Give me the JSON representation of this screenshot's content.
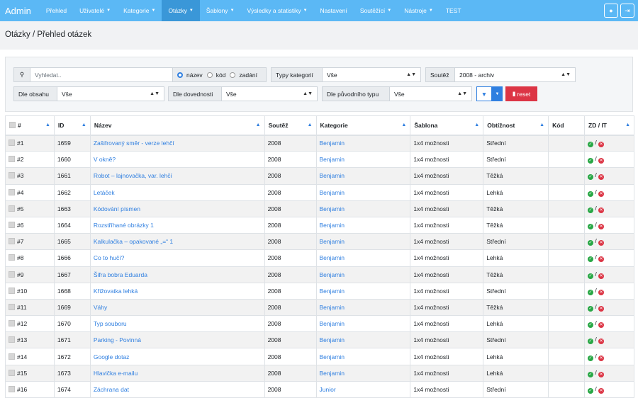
{
  "nav": {
    "brand": "Admin",
    "items": [
      {
        "label": "Přehled",
        "caret": false,
        "active": false
      },
      {
        "label": "Uživatelé",
        "caret": true,
        "active": false
      },
      {
        "label": "Kategorie",
        "caret": true,
        "active": false
      },
      {
        "label": "Otázky",
        "caret": true,
        "active": true
      },
      {
        "label": "Šablony",
        "caret": true,
        "active": false
      },
      {
        "label": "Výsledky a statistiky",
        "caret": true,
        "active": false
      },
      {
        "label": "Nastavení",
        "caret": false,
        "active": false
      },
      {
        "label": "Soutěžící",
        "caret": true,
        "active": false
      },
      {
        "label": "Nástroje",
        "caret": true,
        "active": false
      },
      {
        "label": "TEST",
        "caret": false,
        "active": false
      }
    ]
  },
  "breadcrumb": "Otázky / Přehled otázek",
  "filters": {
    "search_placeholder": "Vyhledat..",
    "radio": [
      "název",
      "kód",
      "zadání"
    ],
    "typy_label": "Typy kategorií",
    "typy_value": "Vše",
    "soutez_label": "Soutěž",
    "soutez_value": "2008 - archiv",
    "obsah_label": "Dle obsahu",
    "obsah_value": "Vše",
    "dovednosti_label": "Dle dovednosti",
    "dovednosti_value": "Vše",
    "puvodni_label": "Dle původního typu",
    "puvodni_value": "Vše",
    "reset_label": "reset"
  },
  "table": {
    "headers": [
      "#",
      "ID",
      "Název",
      "Soutěž",
      "Kategorie",
      "Šablona",
      "Obtížnost",
      "Kód",
      "ZD / IT"
    ],
    "rows": [
      {
        "num": "#1",
        "id": "1659",
        "name": "Zašifrovaný směr - verze lehčí",
        "soutez": "2008",
        "kat": "Benjamin",
        "sablona": "1x4 možnosti",
        "obt": "Střední"
      },
      {
        "num": "#2",
        "id": "1660",
        "name": "V okně?",
        "soutez": "2008",
        "kat": "Benjamin",
        "sablona": "1x4 možnosti",
        "obt": "Střední"
      },
      {
        "num": "#3",
        "id": "1661",
        "name": "Robot – lajnovačka, var. lehčí",
        "soutez": "2008",
        "kat": "Benjamin",
        "sablona": "1x4 možnosti",
        "obt": "Těžká"
      },
      {
        "num": "#4",
        "id": "1662",
        "name": "Letáček",
        "soutez": "2008",
        "kat": "Benjamin",
        "sablona": "1x4 možnosti",
        "obt": "Lehká"
      },
      {
        "num": "#5",
        "id": "1663",
        "name": "Kódování písmen",
        "soutez": "2008",
        "kat": "Benjamin",
        "sablona": "1x4 možnosti",
        "obt": "Těžká"
      },
      {
        "num": "#6",
        "id": "1664",
        "name": "Rozstříhané obrázky 1",
        "soutez": "2008",
        "kat": "Benjamin",
        "sablona": "1x4 možnosti",
        "obt": "Těžká"
      },
      {
        "num": "#7",
        "id": "1665",
        "name": "Kalkulačka – opakované „=“ 1",
        "soutez": "2008",
        "kat": "Benjamin",
        "sablona": "1x4 možnosti",
        "obt": "Střední"
      },
      {
        "num": "#8",
        "id": "1666",
        "name": "Co to hučí?",
        "soutez": "2008",
        "kat": "Benjamin",
        "sablona": "1x4 možnosti",
        "obt": "Lehká"
      },
      {
        "num": "#9",
        "id": "1667",
        "name": "Šifra bobra Eduarda",
        "soutez": "2008",
        "kat": "Benjamin",
        "sablona": "1x4 možnosti",
        "obt": "Těžká"
      },
      {
        "num": "#10",
        "id": "1668",
        "name": "Křižovatka lehká",
        "soutez": "2008",
        "kat": "Benjamin",
        "sablona": "1x4 možnosti",
        "obt": "Střední"
      },
      {
        "num": "#11",
        "id": "1669",
        "name": "Váhy",
        "soutez": "2008",
        "kat": "Benjamin",
        "sablona": "1x4 možnosti",
        "obt": "Těžká"
      },
      {
        "num": "#12",
        "id": "1670",
        "name": "Typ souboru",
        "soutez": "2008",
        "kat": "Benjamin",
        "sablona": "1x4 možnosti",
        "obt": "Lehká"
      },
      {
        "num": "#13",
        "id": "1671",
        "name": "Parking - Povinná",
        "soutez": "2008",
        "kat": "Benjamin",
        "sablona": "1x4 možnosti",
        "obt": "Střední"
      },
      {
        "num": "#14",
        "id": "1672",
        "name": "Google dotaz",
        "soutez": "2008",
        "kat": "Benjamin",
        "sablona": "1x4 možnosti",
        "obt": "Lehká"
      },
      {
        "num": "#15",
        "id": "1673",
        "name": "Hlavička e-mailu",
        "soutez": "2008",
        "kat": "Benjamin",
        "sablona": "1x4 možnosti",
        "obt": "Lehká"
      },
      {
        "num": "#16",
        "id": "1674",
        "name": "Záchrana dat",
        "soutez": "2008",
        "kat": "Junior",
        "sablona": "1x4 možnosti",
        "obt": "Střední"
      }
    ]
  },
  "colors": {
    "navbar": "#5bb8f5",
    "active": "#3a97d8",
    "link": "#2f7fe0",
    "reset": "#dc3545",
    "filter_btn": "#2f7fe0"
  },
  "icons": {
    "user": "user-icon",
    "logout": "sign-out-icon",
    "search": "search-icon",
    "filter": "filter-icon",
    "trash": "trash-icon",
    "check": "check-circle-icon",
    "cross": "times-circle-icon"
  }
}
